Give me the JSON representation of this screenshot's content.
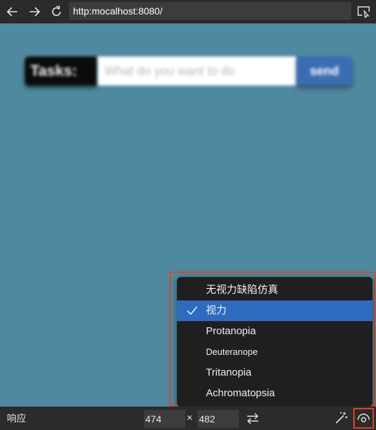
{
  "toolbar": {
    "url": "http:mocalhost:8080/"
  },
  "page": {
    "task_label": "Tasks:",
    "task_placeholder": "What do you want to do",
    "send_label": "send"
  },
  "vision_menu": {
    "items": [
      {
        "label": "无视力缺陷仿真",
        "selected": false
      },
      {
        "label": "视力",
        "selected": true
      },
      {
        "label": "Protanopia",
        "selected": false
      },
      {
        "label": "Deuteranope",
        "selected": false
      },
      {
        "label": "Tritanopia",
        "selected": false
      },
      {
        "label": "Achromatopsia",
        "selected": false
      }
    ]
  },
  "bottom": {
    "mode": "响应",
    "width": "474",
    "times": "×",
    "height": "482"
  },
  "colors": {
    "viewport_bg": "#4f89a0",
    "selected": "#2f6bbd",
    "highlight": "#d9442e"
  }
}
